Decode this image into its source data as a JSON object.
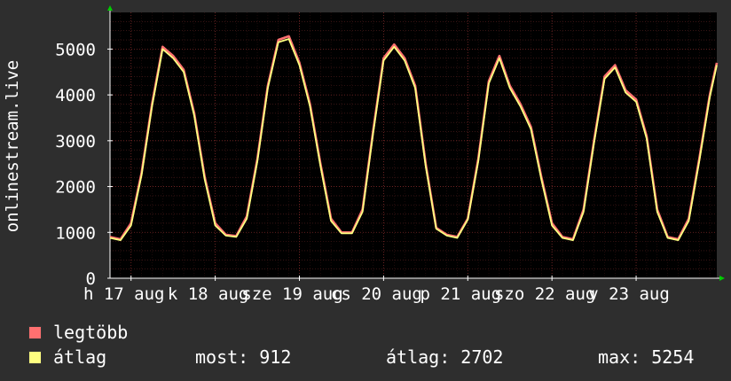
{
  "chart_data": {
    "type": "line",
    "ylabel": "onlinestream.live",
    "ylim": [
      0,
      5800
    ],
    "yticks": [
      0,
      1000,
      2000,
      3000,
      4000,
      5000
    ],
    "xtick_labels": [
      "h 17 aug",
      "k 18 aug",
      "sze 19 aug",
      "cs 20 aug",
      "p 21 aug",
      "szo 22 aug",
      "v 23 aug"
    ],
    "x_start": "2020-08-16 18:00",
    "x_end": "2020-08-23 23:00",
    "grid": true,
    "background": "#000000",
    "colors": {
      "max": "#ff7070",
      "avg": "#ffff80",
      "grid": "#5a2020",
      "axis": "#ffffff"
    },
    "series": [
      {
        "name": "legtöbb",
        "color": "#ff7070",
        "x_hours": [
          0,
          3,
          6,
          9,
          12,
          15,
          18,
          21,
          24,
          27,
          30,
          33,
          36,
          39,
          42,
          45,
          48,
          51,
          54,
          57,
          60,
          63,
          66,
          69,
          72,
          75,
          78,
          81,
          84,
          87,
          90,
          93,
          96,
          99,
          102,
          105,
          108,
          111,
          114,
          117,
          120,
          123,
          126,
          129,
          132,
          135,
          138,
          141,
          144,
          147,
          150,
          153,
          156,
          159,
          162,
          165,
          168,
          171,
          173
        ],
        "values": [
          900,
          850,
          1200,
          2300,
          3800,
          5050,
          4850,
          4550,
          3600,
          2200,
          1200,
          950,
          920,
          1350,
          2600,
          4200,
          5200,
          5280,
          4700,
          3800,
          2500,
          1300,
          1000,
          1000,
          1500,
          3200,
          4800,
          5100,
          4800,
          4200,
          2500,
          1100,
          950,
          900,
          1300,
          2600,
          4300,
          4850,
          4200,
          3800,
          3300,
          2200,
          1200,
          900,
          850,
          1500,
          3000,
          4400,
          4650,
          4100,
          3900,
          3100,
          1500,
          900,
          850,
          1300,
          2600,
          4000,
          4700
        ]
      },
      {
        "name": "átlag",
        "color": "#ffff80",
        "x_hours": [
          0,
          3,
          6,
          9,
          12,
          15,
          18,
          21,
          24,
          27,
          30,
          33,
          36,
          39,
          42,
          45,
          48,
          51,
          54,
          57,
          60,
          63,
          66,
          69,
          72,
          75,
          78,
          81,
          84,
          87,
          90,
          93,
          96,
          99,
          102,
          105,
          108,
          111,
          114,
          117,
          120,
          123,
          126,
          129,
          132,
          135,
          138,
          141,
          144,
          147,
          150,
          153,
          156,
          159,
          162,
          165,
          168,
          171,
          173
        ],
        "values": [
          880,
          830,
          1150,
          2250,
          3750,
          5000,
          4800,
          4500,
          3550,
          2150,
          1150,
          930,
          900,
          1300,
          2550,
          4150,
          5150,
          5220,
          4650,
          3750,
          2450,
          1250,
          980,
          980,
          1450,
          3150,
          4750,
          5050,
          4750,
          4150,
          2450,
          1080,
          930,
          880,
          1280,
          2550,
          4250,
          4800,
          4150,
          3750,
          3250,
          2150,
          1150,
          880,
          830,
          1450,
          2950,
          4350,
          4600,
          4050,
          3850,
          3050,
          1450,
          880,
          830,
          1250,
          2550,
          3950,
          4650
        ]
      }
    ]
  },
  "legend": [
    {
      "label": "legtöbb",
      "color": "#ff7070"
    },
    {
      "label": "átlag",
      "color": "#ffff80"
    }
  ],
  "stats": {
    "most": "most: 912",
    "atlag": "átlag: 2702",
    "max": "max: 5254"
  }
}
